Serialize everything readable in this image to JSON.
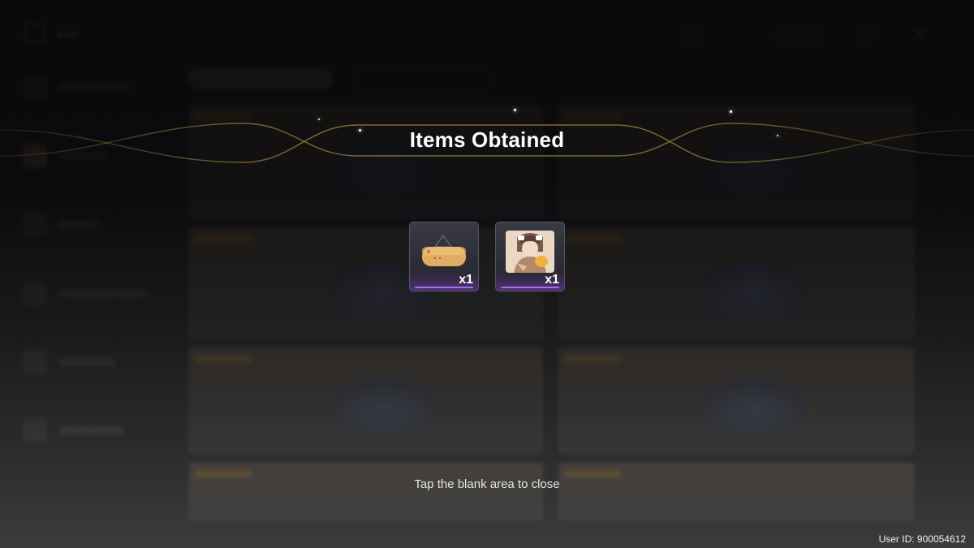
{
  "dialog": {
    "title": "Items Obtained",
    "close_hint": "Tap the blank area to close"
  },
  "items": [
    {
      "name": "bread-pet-item",
      "icon": "bread-loaf-icon",
      "quantity": "x1",
      "rarity_color": "#b27cff"
    },
    {
      "name": "character-portrait-item",
      "icon": "character-portrait-icon",
      "quantity": "x1",
      "rarity_color": "#b27cff"
    }
  ],
  "footer": {
    "user_id": "User ID: 900054612"
  },
  "colors": {
    "banner_gold": "#8a7436",
    "rarity_purple": "#b27cff"
  }
}
